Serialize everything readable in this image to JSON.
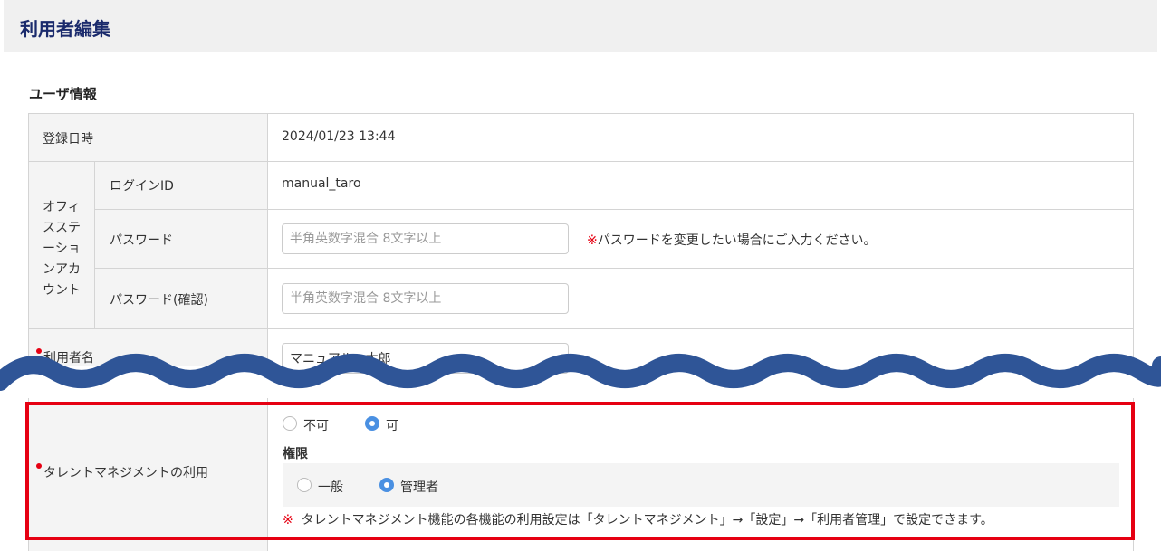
{
  "page": {
    "title": "利用者編集"
  },
  "section": {
    "title": "ユーザ情報"
  },
  "rows": {
    "registered": {
      "label": "登録日時",
      "value": "2024/01/23 13:44"
    },
    "office_account": {
      "label_lines": [
        "オフィ",
        "スステ",
        "ーショ",
        "ンアカ",
        "ウント"
      ]
    },
    "login_id": {
      "label": "ログインID",
      "value": "manual_taro"
    },
    "password": {
      "label": "パスワード",
      "placeholder": "半角英数字混合 8文字以上",
      "note_mark": "※",
      "note": "パスワードを変更したい場合にご入力ください。"
    },
    "password_confirm": {
      "label": "パスワード(確認)",
      "placeholder": "半角英数字混合 8文字以上"
    },
    "user_name": {
      "label": "利用者名",
      "value": "マニュアル　太郎"
    },
    "talent": {
      "label": "タレントマネジメントの利用",
      "options": [
        {
          "label": "不可",
          "selected": false
        },
        {
          "label": "可",
          "selected": true
        }
      ],
      "authority": {
        "title": "権限",
        "options": [
          {
            "label": "一般",
            "selected": false
          },
          {
            "label": "管理者",
            "selected": true
          }
        ]
      },
      "note_mark": "※",
      "note": "タレントマネジメント機能の各機能の利用設定は「タレントマネジメント」→「設定」→「利用者管理」で設定できます。"
    }
  },
  "colors": {
    "title": "#1a2a6c",
    "required": "#e60012",
    "highlight": "#e60012",
    "wave": "#2f5597",
    "radio_on": "#4a90e2"
  }
}
